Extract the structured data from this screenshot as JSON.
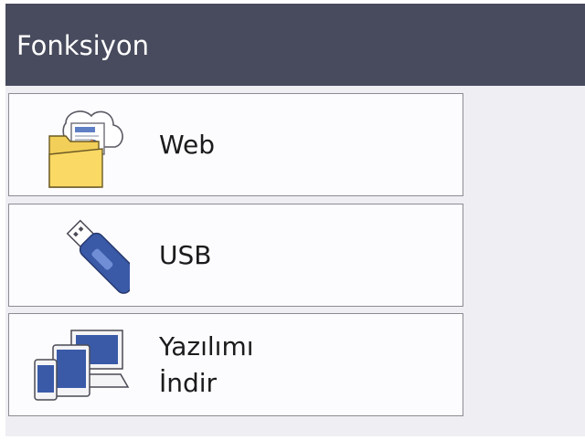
{
  "header": {
    "title": "Fonksiyon"
  },
  "menu": {
    "items": [
      {
        "id": "web",
        "label": "Web",
        "icon": "web-folder-cloud-icon"
      },
      {
        "id": "usb",
        "label": "USB",
        "icon": "usb-drive-icon"
      },
      {
        "id": "download",
        "label_line1": "Yazılımı",
        "label_line2": "İndir",
        "icon": "devices-download-icon"
      }
    ]
  },
  "colors": {
    "header_bg": "#484b5d",
    "content_bg": "#eeeef3",
    "button_bg": "#fcfbfd",
    "button_border": "#8c8c94"
  }
}
